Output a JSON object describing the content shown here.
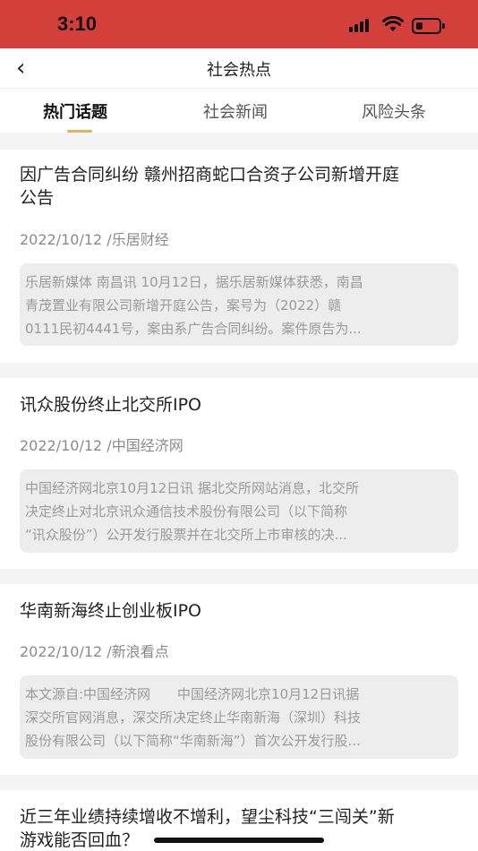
{
  "status": {
    "time": "3:10"
  },
  "nav": {
    "back_glyph": "‹",
    "title": "社会热点"
  },
  "tabs": [
    {
      "label": "热门话题",
      "active": true
    },
    {
      "label": "社会新闻",
      "active": false
    },
    {
      "label": "风险头条",
      "active": false
    }
  ],
  "articles": [
    {
      "title_lines": [
        "因广告合同纠纷 赣州招商蛇口合资子公司新增开庭",
        "公告"
      ],
      "meta": "2022/10/12 /乐居财经",
      "summary_lines": [
        "乐居新媒体 南昌讯 10月12日，据乐居新媒体获悉，南昌",
        "青茂置业有限公司新增开庭公告，案号为（2022）赣",
        "0111民初4441号，案由系广告合同纠纷。案件原告为..."
      ]
    },
    {
      "title_lines": [
        "讯众股份终止北交所IPO"
      ],
      "meta": "2022/10/12 /中国经济网",
      "summary_lines": [
        "中国经济网北京10月12日讯 据北交所网站消息，北交所",
        "决定终止对北京讯众通信技术股份有限公司（以下简称",
        "“讯众股份”）公开发行股票并在北交所上市审核的决..."
      ]
    },
    {
      "title_lines": [
        "华南新海终止创业板IPO"
      ],
      "meta": "2022/10/12 /新浪看点",
      "summary_lines": [
        "本文源自:中国经济网　　中国经济网北京10月12日讯据",
        "深交所官网消息，深交所决定终止华南新海（深圳）科技",
        "股份有限公司（以下简称“华南新海”）首次公开发行股..."
      ]
    },
    {
      "title_lines": [
        "近三年业绩持续增收不增利，望尘科技“三闯关”新",
        "游戏能否回血？"
      ]
    }
  ]
}
